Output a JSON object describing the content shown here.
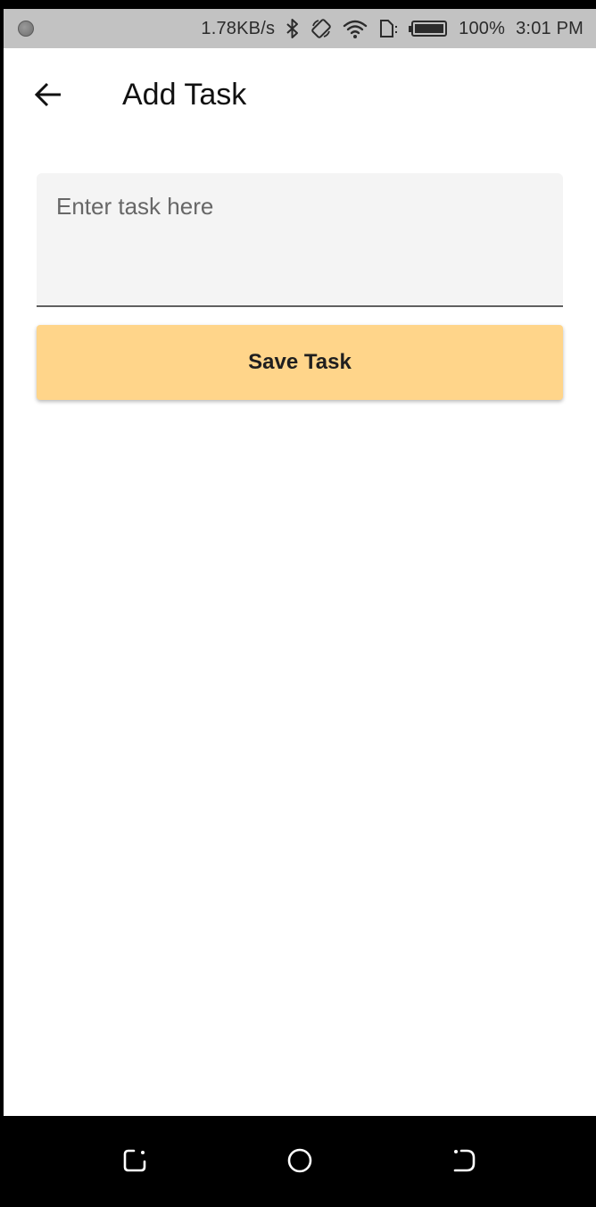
{
  "status_bar": {
    "speed": "1.78KB/s",
    "battery": "100%",
    "time": "3:01 PM",
    "icons": [
      "notification-dot-icon",
      "bluetooth-icon",
      "rotation-lock-icon",
      "wifi-icon",
      "sim-icon",
      "battery-icon"
    ]
  },
  "app_bar": {
    "title": "Add Task",
    "back_icon": "arrow-left-icon"
  },
  "task_input": {
    "value": "",
    "placeholder": "Enter task here"
  },
  "save_button": {
    "label": "Save Task",
    "color": "#ffd58a"
  },
  "nav_bar": {
    "icons": [
      "recents-icon",
      "home-icon",
      "back-icon"
    ]
  }
}
